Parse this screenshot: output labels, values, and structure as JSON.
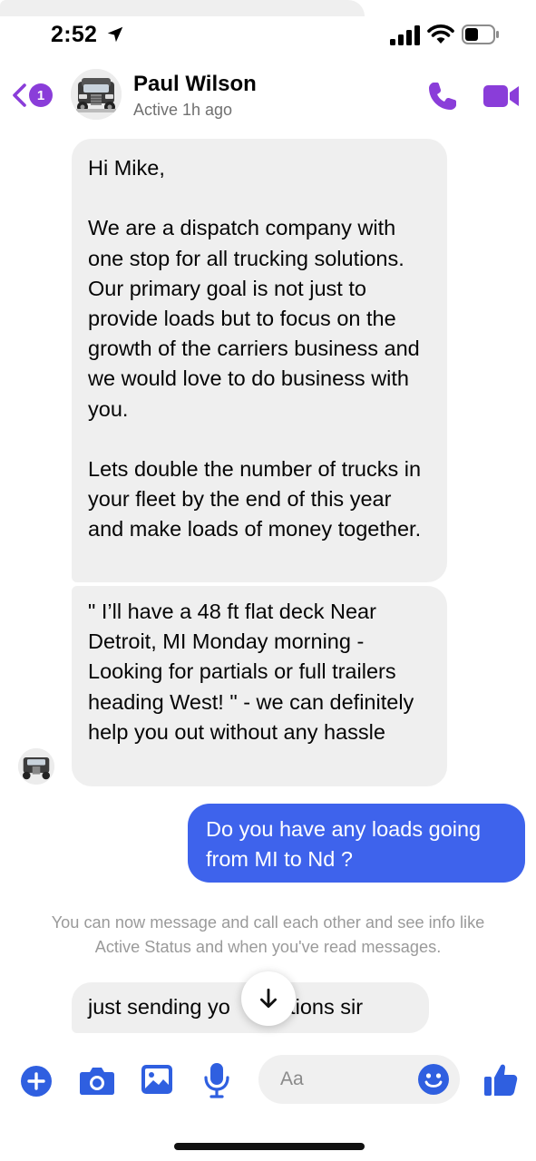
{
  "status_bar": {
    "time": "2:52",
    "icons": [
      "location-arrow-icon",
      "cellular-signal-icon",
      "wifi-icon",
      "battery-icon"
    ]
  },
  "header": {
    "back_badge_count": "1",
    "contact_name": "Paul Wilson",
    "contact_status": "Active 1h ago",
    "icons": [
      "chevron-left-icon",
      "phone-icon",
      "video-camera-icon"
    ],
    "accent_color": "#8a3dd9"
  },
  "messages": [
    {
      "direction": "incoming",
      "text": "Hi Mike,\n\nWe are a dispatch company with one stop for all trucking solutions. Our primary goal is not just to provide loads but to focus on the growth of the carriers business and we would love to do business with you.\n\nLets double the number of trucks in your fleet by the end of this year and make loads of money together."
    },
    {
      "direction": "incoming",
      "text": "\" I’ll have a 48 ft flat deck Near Detroit, MI Monday morning - Looking for partials or full trailers heading West! \" - we can definitely help you out without any hassle"
    },
    {
      "direction": "outgoing",
      "text": "Do you have any loads going from MI to Nd ?"
    },
    {
      "direction": "incoming",
      "text": "just sending yo   e options sir"
    }
  ],
  "system_note": "You can now message and call each other and see info like Active Status and when you've read messages.",
  "composer": {
    "input_placeholder": "Aa",
    "icons": [
      "plus-icon",
      "camera-icon",
      "image-icon",
      "microphone-icon",
      "emoji-icon",
      "thumbs-up-icon"
    ],
    "accent_color": "#3e63ec"
  },
  "colors": {
    "incoming_bubble": "#efefef",
    "outgoing_bubble": "#3e63ec"
  }
}
